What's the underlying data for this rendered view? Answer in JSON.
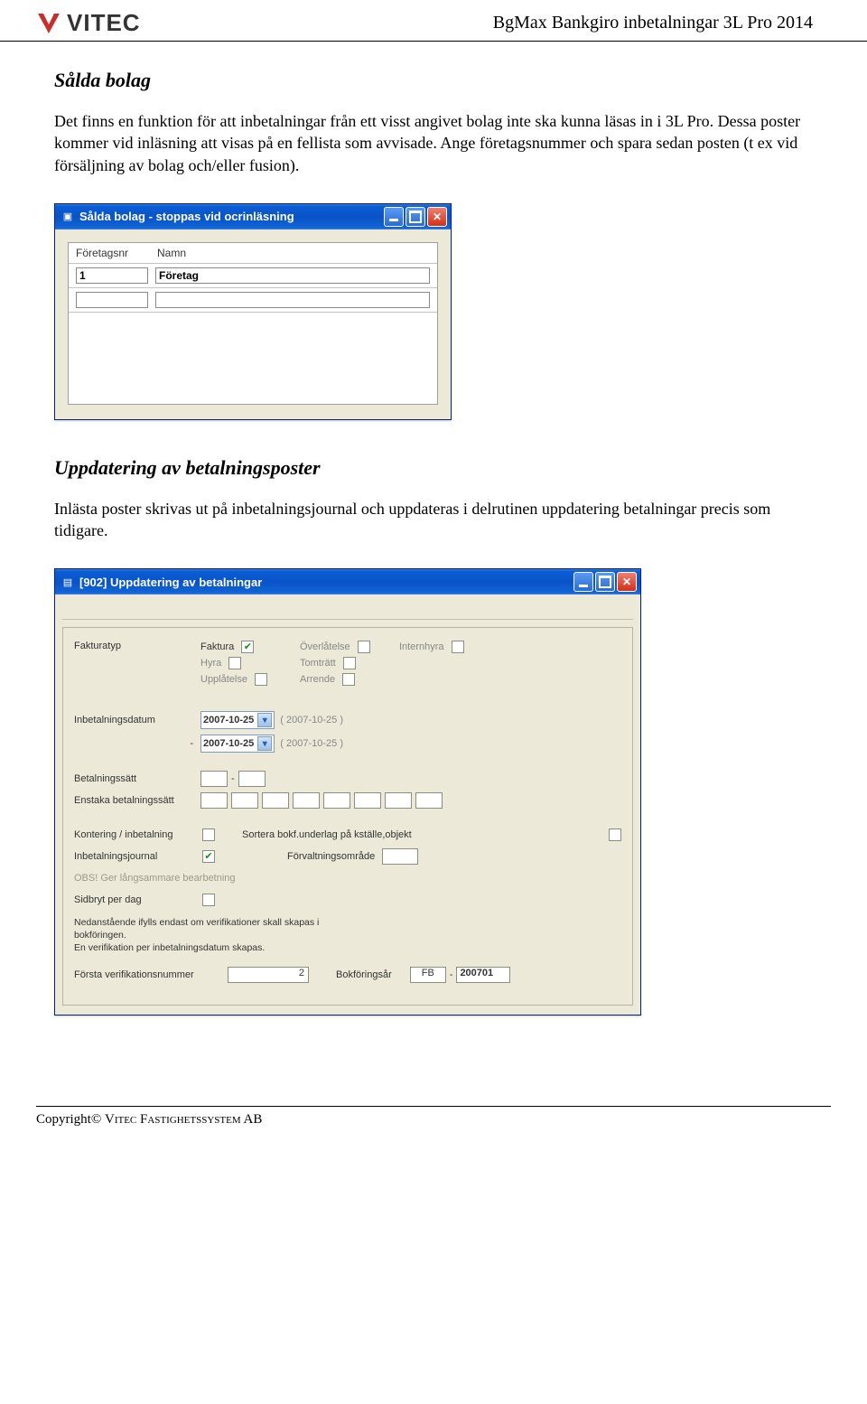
{
  "header": {
    "logo_text": "VITEC",
    "doc_title": "BgMax Bankgiro inbetalningar 3L Pro 2014"
  },
  "section1": {
    "heading": "Sålda bolag",
    "paragraph": "Det finns en funktion för att inbetalningar från ett visst angivet bolag inte ska kunna läsas in i 3L Pro. Dessa poster kommer vid inläsning att visas på en fellista som avvisade. Ange företagsnummer och spara sedan posten (t ex vid försäljning av bolag och/eller fusion)."
  },
  "win1": {
    "title": "Sålda bolag - stoppas vid ocrinläsning",
    "col_nr": "Företagsnr",
    "col_namn": "Namn",
    "rows": [
      {
        "nr": "1",
        "namn": "Företag"
      },
      {
        "nr": "",
        "namn": ""
      }
    ]
  },
  "section2": {
    "heading": "Uppdatering av betalningsposter",
    "paragraph": "Inlästa poster skrivas ut på inbetalningsjournal och uppdateras i delrutinen uppdatering betalningar precis som tidigare."
  },
  "win2": {
    "title": "[902]  Uppdatering av betalningar",
    "labels": {
      "fakturatyp": "Fakturatyp",
      "inbetdatum": "Inbetalningsdatum",
      "betsatt": "Betalningssätt",
      "enstaka": "Enstaka betalningssätt",
      "kontering": "Kontering / inbetalning",
      "sortera": "Sortera bokf.underlag på kställe,objekt",
      "journal": "Inbetalningsjournal",
      "forvalt": "Förvaltningsområde",
      "obs": "OBS! Ger långsammare bearbetning",
      "sidbryt": "Sidbryt per dag",
      "note": "Nedanstående ifylls endast om verifikationer skall skapas i bokföringen.\nEn verifikation per inbetalningsdatum skapas.",
      "verifnr": "Första verifikationsnummer",
      "bokfar": "Bokföringsår"
    },
    "fakturatyp_options": [
      {
        "label": "Faktura",
        "checked": true,
        "enabled": true
      },
      {
        "label": "Överlåtelse",
        "checked": false,
        "enabled": false
      },
      {
        "label": "Internhyra",
        "checked": false,
        "enabled": false
      },
      {
        "label": "Hyra",
        "checked": false,
        "enabled": false
      },
      {
        "label": "Tomträtt",
        "checked": false,
        "enabled": false
      },
      {
        "label": "Upplåtelse",
        "checked": false,
        "enabled": false
      },
      {
        "label": "Arrende",
        "checked": false,
        "enabled": false
      }
    ],
    "date_from": "2007-10-25",
    "date_to": "2007-10-25",
    "date_from_hint": "( 2007-10-25 )",
    "date_to_hint": "( 2007-10-25 )",
    "date_range_dash": "-",
    "betsatt_dash": "-",
    "kontering_checked": false,
    "sortera_checked": false,
    "journal_checked": true,
    "sidbryt_checked": false,
    "verifnr_value": "2",
    "bokfar_prefix": "FB",
    "bokfar_dash": "-",
    "bokfar_value": "200701"
  },
  "footer": {
    "text_prefix": "Copyright© ",
    "text_sc": "Vitec Fastighetssystem AB"
  }
}
